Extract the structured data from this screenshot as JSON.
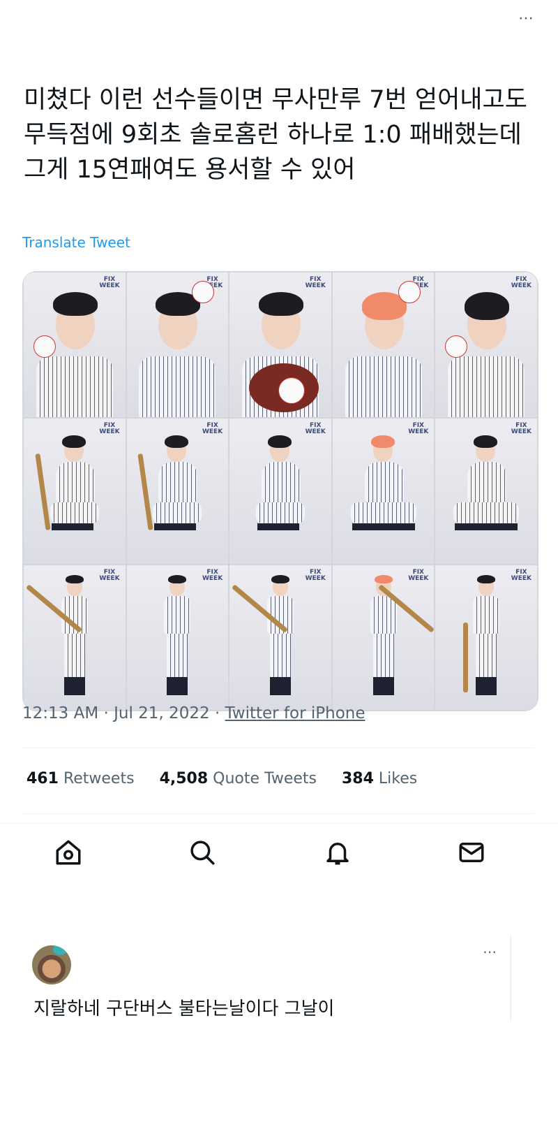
{
  "tweet": {
    "text": "미쳤다 이런 선수들이면 무사만루 7번 얻어내고도 무득점에 9회초 솔로홈런 하나로 1:0 패배했는데 그게 15연패여도 용서할 수 있어",
    "translate_label": "Translate Tweet",
    "more_icon": "⋯",
    "media": {
      "logo_text": "FIX WEEK",
      "cells": [
        {
          "pose": "portrait",
          "hair": "#1c1c22",
          "cap": true,
          "ball": true
        },
        {
          "pose": "portrait",
          "hair": "#2a2a30",
          "cap": true,
          "ball": true
        },
        {
          "pose": "portrait",
          "hair": "#1c1c22",
          "cap": true,
          "glove": true
        },
        {
          "pose": "portrait",
          "hair": "#f08a6a",
          "cap": false,
          "ball": true
        },
        {
          "pose": "portrait",
          "hair": "#1c1c22",
          "cap": false,
          "ball": true
        },
        {
          "pose": "crouch",
          "hair": "#1c1c22",
          "bat": true
        },
        {
          "pose": "crouch",
          "hair": "#1c1c22",
          "bat": true
        },
        {
          "pose": "crouch",
          "hair": "#1c1c22"
        },
        {
          "pose": "sit",
          "hair": "#f08a6a"
        },
        {
          "pose": "sit",
          "hair": "#1c1c22"
        },
        {
          "pose": "stand",
          "hair": "#1c1c22",
          "bat": true
        },
        {
          "pose": "stand",
          "hair": "#1c1c22"
        },
        {
          "pose": "stand",
          "hair": "#1c1c22",
          "bat": true
        },
        {
          "pose": "stand",
          "hair": "#f08a6a",
          "bat": true
        },
        {
          "pose": "stand",
          "hair": "#1c1c22",
          "bat": true
        }
      ]
    },
    "time": "12:13 AM",
    "date": "Jul 21, 2022",
    "separator": "·",
    "source": "Twitter for iPhone",
    "stats": {
      "retweets_count": "461",
      "retweets_label": "Retweets",
      "quotes_count": "4,508",
      "quotes_label": "Quote Tweets",
      "likes_count": "384",
      "likes_label": "Likes"
    }
  },
  "tabbar": {
    "items": [
      "home-icon",
      "search-icon",
      "notifications-icon",
      "messages-icon"
    ]
  },
  "comment": {
    "text": "지랄하네 구단버스 불타는날이다 그날이",
    "more_icon": "⋯"
  },
  "colors": {
    "link": "#1d9bf0",
    "muted": "#536471",
    "text": "#0f1419"
  }
}
